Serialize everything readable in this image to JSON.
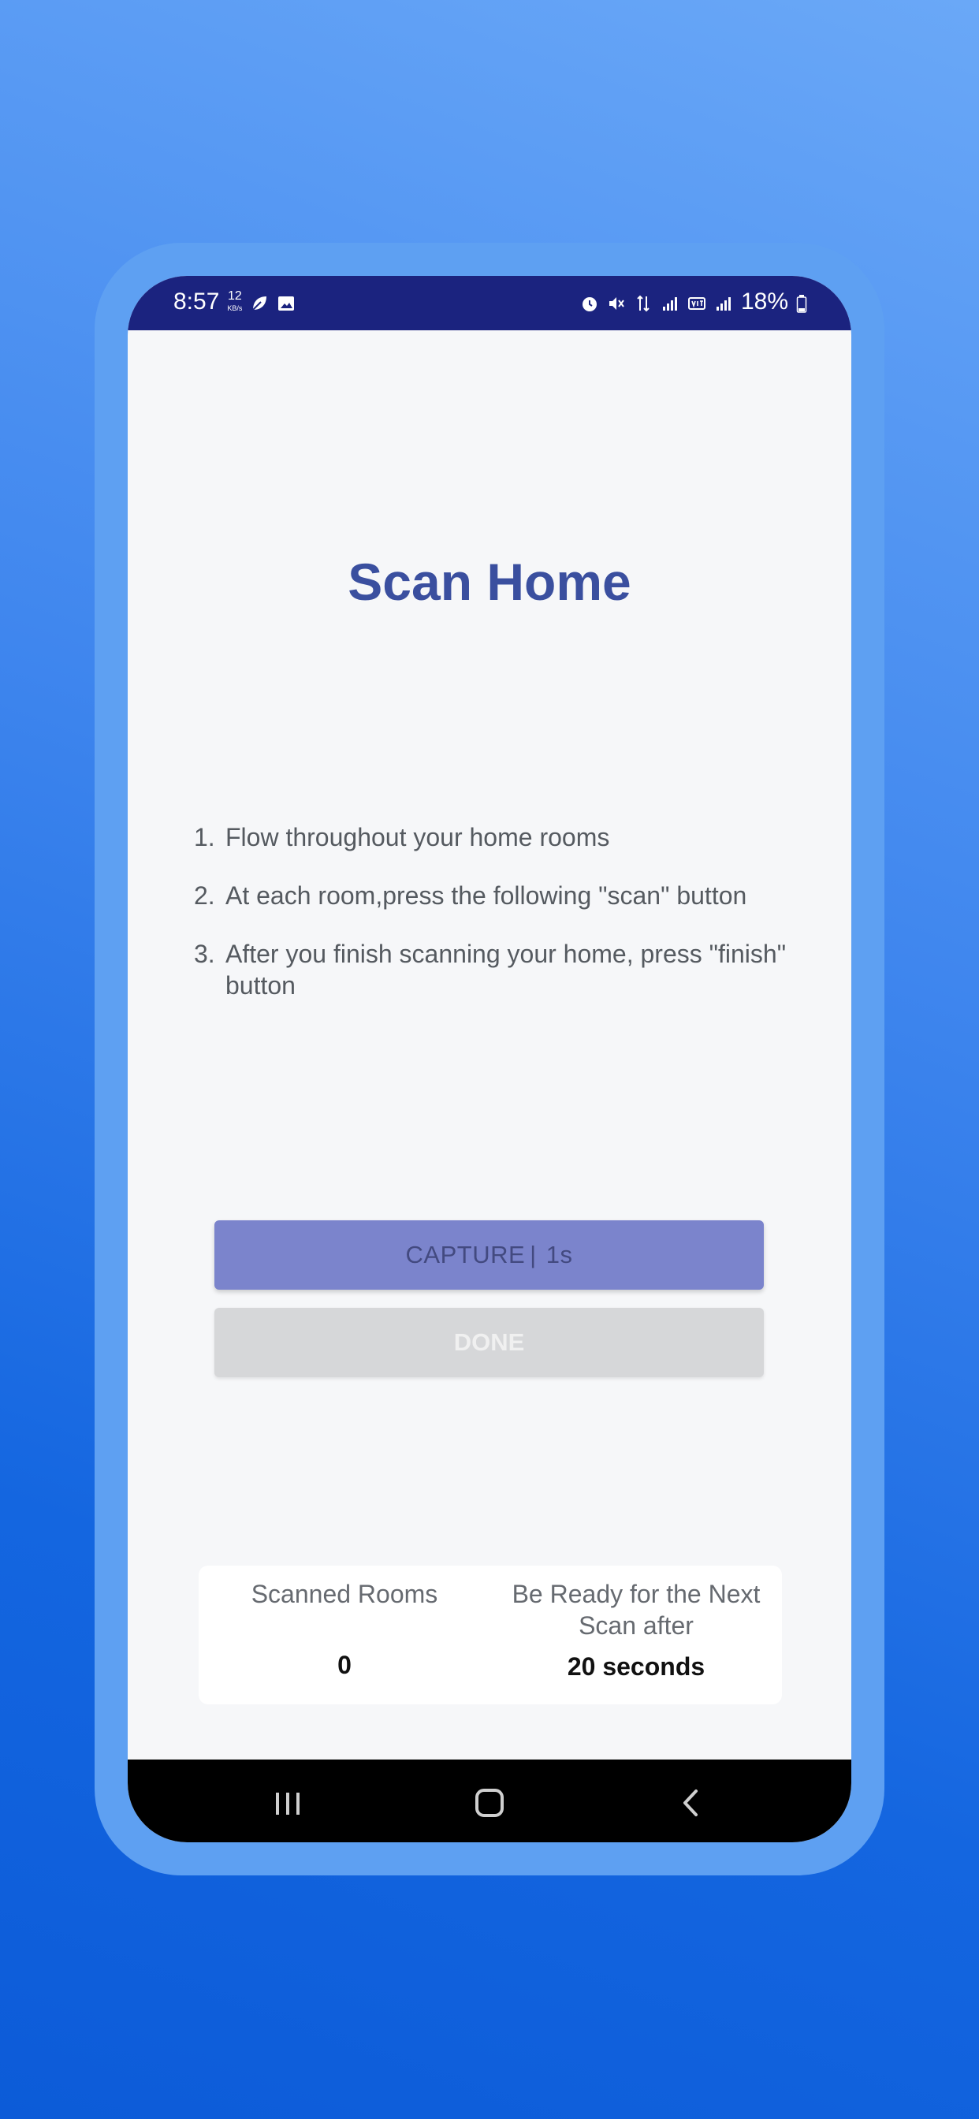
{
  "status_bar": {
    "time": "8:57",
    "net_speed_value": "12",
    "net_speed_unit": "KB/s",
    "battery": "18%",
    "icons": [
      "leaf-icon",
      "image-icon",
      "alarm-icon",
      "mute-icon",
      "data-4g-icon",
      "signal-icon",
      "volte-icon",
      "signal-icon",
      "battery-icon"
    ]
  },
  "page": {
    "title": "Scan Home"
  },
  "steps": [
    {
      "num": "1.",
      "text": "Flow throughout your home rooms"
    },
    {
      "num": "2.",
      "text": "At each room,press the following \"scan\" button"
    },
    {
      "num": "3.",
      "text": "After you finish scanning  your home, press \"finish\" button"
    }
  ],
  "buttons": {
    "capture_label": "CAPTURE",
    "capture_separator": "|",
    "capture_timer": "1s",
    "done_label": "DONE"
  },
  "stats": {
    "scanned_rooms_label": "Scanned Rooms",
    "scanned_rooms_value": "0",
    "next_scan_label": "Be Ready for the Next Scan after",
    "next_scan_value": "20 seconds"
  },
  "nav_bar": {
    "icons": [
      "recents-icon",
      "home-icon",
      "back-icon"
    ]
  },
  "colors": {
    "status_bar_bg": "#1b237f",
    "title": "#3a4f9f",
    "capture_button": "#7b84cc",
    "done_button": "#d6d7d9",
    "background_gradient": [
      "#6aa8f7",
      "#0c5bd8"
    ],
    "device_frame": "#5ea0f2"
  }
}
